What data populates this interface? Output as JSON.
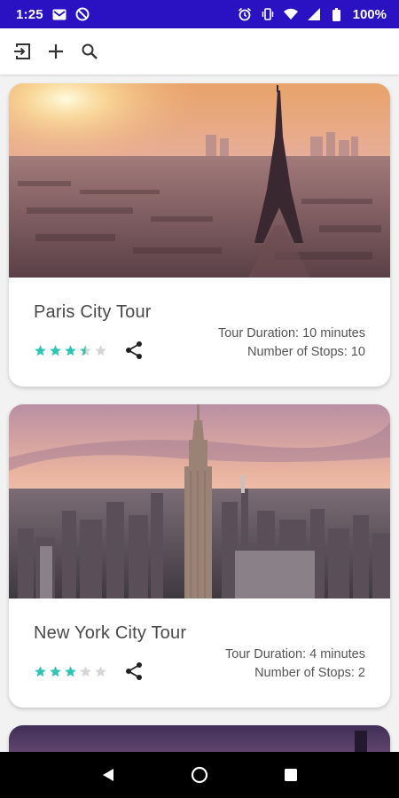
{
  "status_bar": {
    "time": "1:25",
    "battery": "100%",
    "left_icons": [
      "gmail-icon",
      "do-not-disturb-icon"
    ],
    "right_icons": [
      "alarm-icon",
      "vibrate-icon",
      "wifi-icon",
      "signal-icon",
      "battery-icon"
    ],
    "background": "#2a11c2"
  },
  "app_bar": {
    "icons": [
      "login-icon",
      "add-icon",
      "search-icon"
    ]
  },
  "tours": [
    {
      "title": "Paris City Tour",
      "duration": "Tour Duration: 10 minutes",
      "stops": "Number of Stops: 10",
      "rating": 3.5,
      "max_rating": 5
    },
    {
      "title": "New York City Tour",
      "duration": "Tour Duration: 4 minutes",
      "stops": "Number of Stops: 2",
      "rating": 3,
      "max_rating": 5
    }
  ],
  "colors": {
    "star_filled": "#2ec4b6",
    "star_empty": "#d6d6d6"
  },
  "nav_bar": {
    "icons": [
      "back-icon",
      "home-icon",
      "recents-icon"
    ]
  }
}
